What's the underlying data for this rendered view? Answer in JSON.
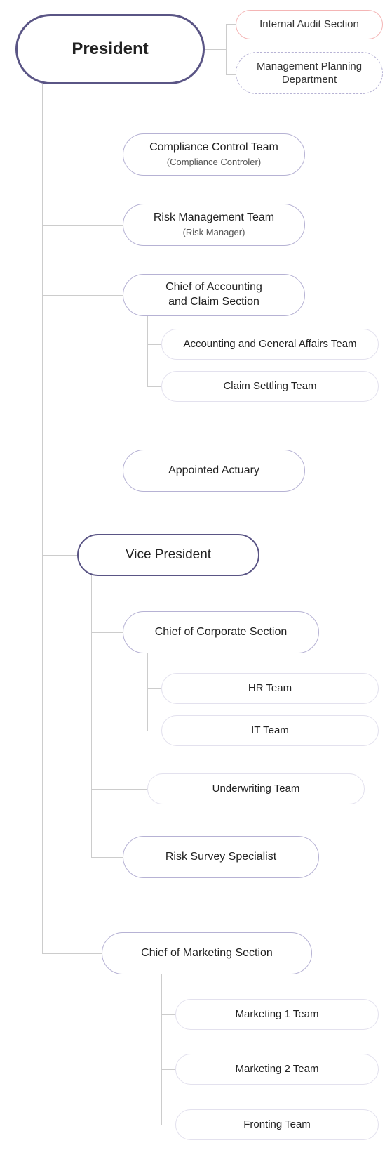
{
  "president": "President",
  "side": {
    "audit": "Internal Audit Section",
    "planning_l1": "Management Planning",
    "planning_l2": "Department"
  },
  "l1": {
    "compliance_l1": "Compliance Control Team",
    "compliance_l2": "(Compliance Controler)",
    "risk_l1": "Risk Management Team",
    "risk_l2": "(Risk Manager)",
    "acct_l1": "Chief of Accounting",
    "acct_l2": "and Claim Section",
    "actuary": "Appointed Actuary",
    "vp": "Vice President",
    "marketing": "Chief of Marketing Section"
  },
  "acct_children": {
    "agat": "Accounting and General Affairs Team",
    "claim": "Claim Settling Team"
  },
  "vp_children": {
    "corp": "Chief of Corporate Section",
    "hr": "HR Team",
    "it": "IT Team",
    "uw": "Underwriting Team",
    "rss": "Risk Survey Specialist"
  },
  "mkt_children": {
    "m1": "Marketing 1 Team",
    "m2": "Marketing 2 Team",
    "fr": "Fronting Team"
  }
}
